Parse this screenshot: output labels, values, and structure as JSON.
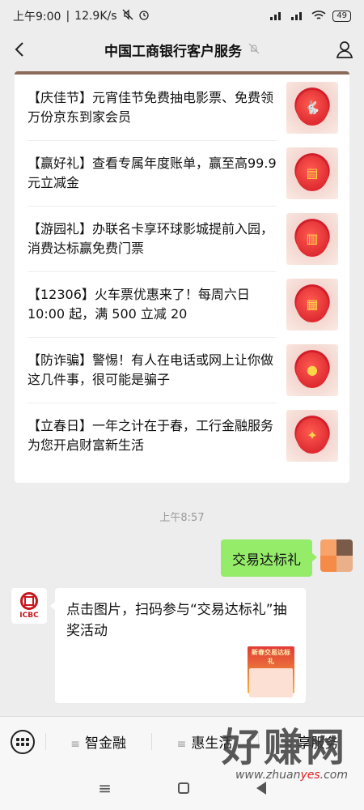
{
  "status_bar": {
    "time": "上午9:00",
    "network_speed": "12.9K/s",
    "battery": "49"
  },
  "header": {
    "title": "中国工商银行客户服务"
  },
  "promo_items": [
    {
      "text": "【庆佳节】元宵佳节免费抽电影票、免费领万份京东到家会员",
      "thumb_icon": "rabbit-icon"
    },
    {
      "text": "【赢好礼】查看专属年度账单，赢至高99.9元立减金",
      "thumb_icon": "bill-icon"
    },
    {
      "text": "【游园礼】办联名卡享环球影城提前入园，消费达标赢免费门票",
      "thumb_icon": "ticket-icon"
    },
    {
      "text": "【12306】火车票优惠来了！每周六日 10:00 起，满 500 立减 20",
      "thumb_icon": "train-icon"
    },
    {
      "text": "【防诈骗】警惕！有人在电话或网上让你做这几件事，很可能是骗子",
      "thumb_icon": "gourd-icon"
    },
    {
      "text": "【立春日】一年之计在于春，工行金融服务为您开启财富新生活",
      "thumb_icon": "bird-icon"
    }
  ],
  "timestamp": "上午8:57",
  "sent_message": "交易达标礼",
  "received_message": {
    "sender_logo_text": "ICBC",
    "text": "点击图片，扫码参与“交易达标礼”抽奖活动",
    "image_title": "新春交易达标礼"
  },
  "bottom_menu": {
    "items": [
      "智金融",
      "惠生活",
      "享服务"
    ]
  },
  "watermark": {
    "big": "好赚网",
    "url_prefix": "www.zhuan",
    "url_highlight": "yes",
    "url_suffix": ".com"
  }
}
